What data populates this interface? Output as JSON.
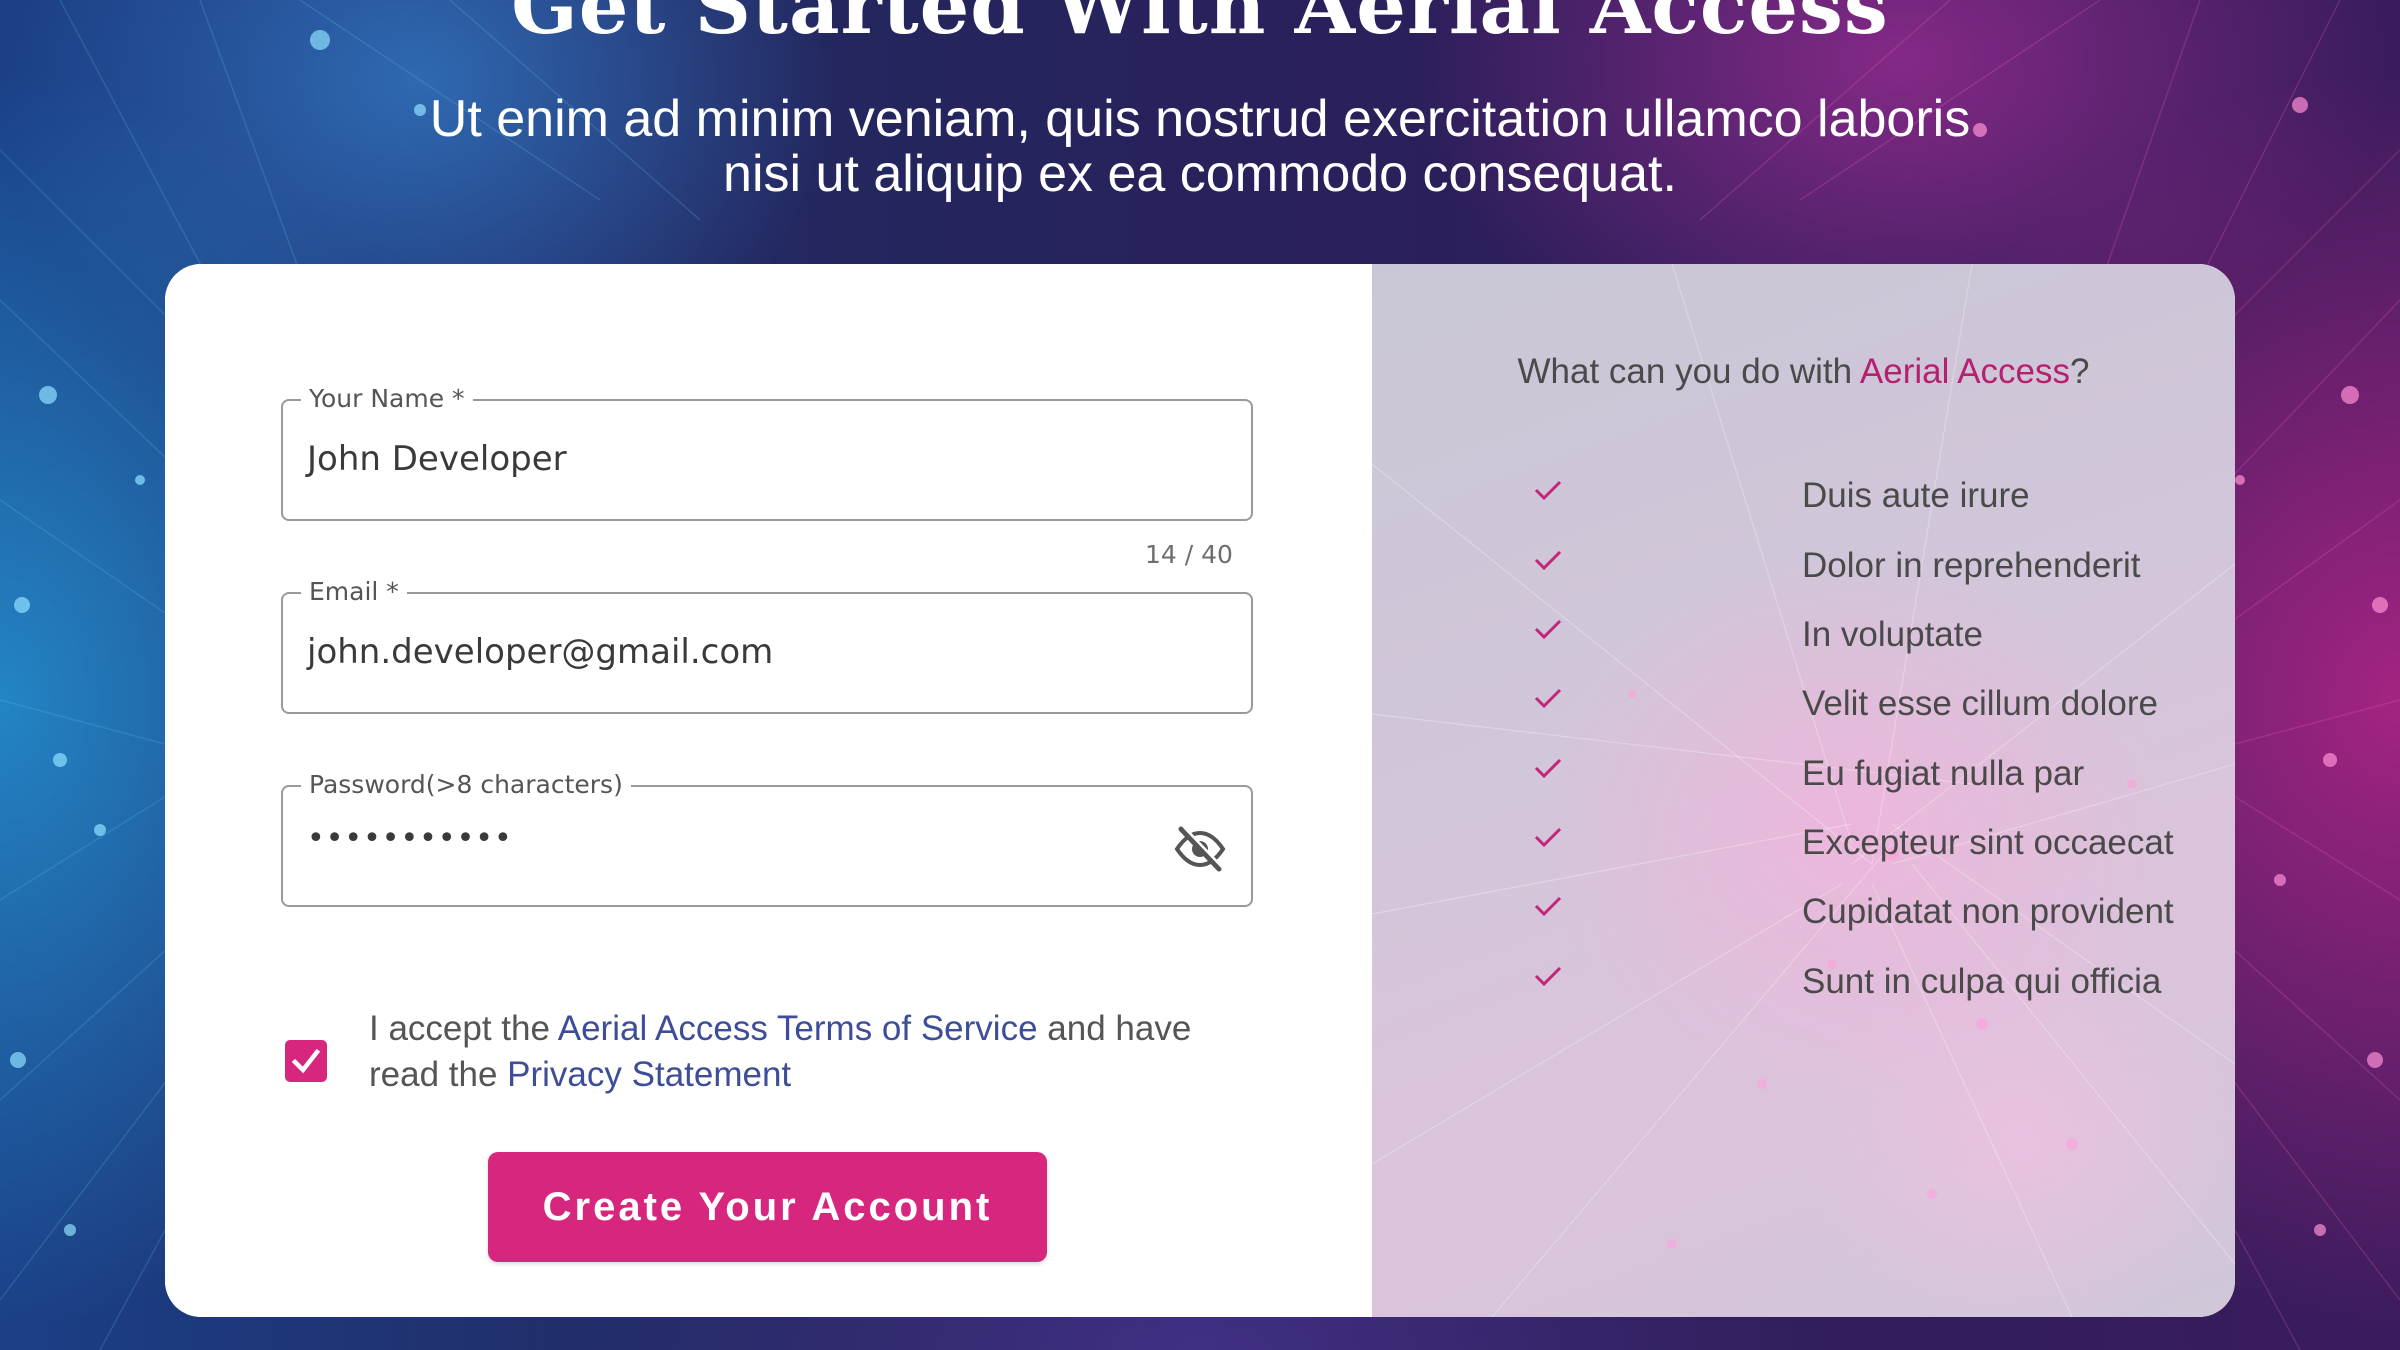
{
  "hero": {
    "title": "Get Started With Aerial Access",
    "subtitle": "Ut enim ad minim veniam, quis nostrud exercitation ullamco laboris nisi ut aliquip ex ea commodo consequat."
  },
  "form": {
    "name": {
      "label": "Your Name *",
      "value": "John Developer",
      "counter": "14 / 40"
    },
    "email": {
      "label": "Email *",
      "value": "john.developer@gmail.com"
    },
    "password": {
      "label": "Password(>8 characters)",
      "masked_value": "•••••••••••",
      "toggle_icon": "eye-off-icon"
    },
    "terms": {
      "checked": true,
      "prefix": "I accept the ",
      "terms_link": "Aerial Access Terms of Service",
      "middle": " and have read the ",
      "privacy_link": "Privacy Statement"
    },
    "submit_label": "Create Your Account"
  },
  "features": {
    "heading_prefix": "What can you do with ",
    "heading_brand": "Aerial Access",
    "heading_suffix": "?",
    "items": [
      "Duis aute irure",
      "Dolor in reprehenderit",
      "In voluptate",
      "Velit esse cillum dolore",
      "Eu fugiat nulla par",
      "Excepteur sint occaecat",
      "Cupidatat non provident",
      "Sunt in culpa qui officia"
    ]
  },
  "colors": {
    "accent": "#d6267e",
    "brand_text": "#b5216e",
    "link": "#3d4d99"
  }
}
